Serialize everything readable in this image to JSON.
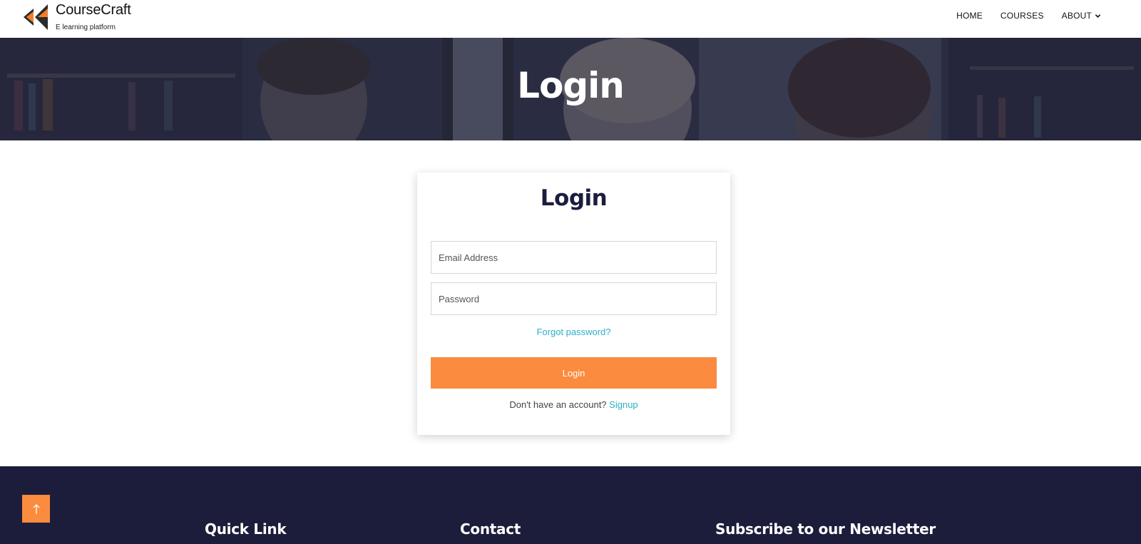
{
  "header": {
    "logo_name": "CourseCraft",
    "logo_tagline": "E learning platform",
    "nav": [
      {
        "label": "HOME"
      },
      {
        "label": "COURSES"
      },
      {
        "label": "ABOUT"
      }
    ]
  },
  "hero": {
    "title": "Login"
  },
  "login_form": {
    "title": "Login",
    "email_placeholder": "Email Address",
    "email_value": "",
    "password_placeholder": "Password",
    "password_value": "",
    "forgot_label": "Forgot password?",
    "submit_label": "Login",
    "signup_prompt": "Don't have an account?",
    "signup_label": "Signup"
  },
  "footer": {
    "quick_link_heading": "Quick Link",
    "contact_heading": "Contact",
    "newsletter_heading": "Subscribe to our Newsletter"
  },
  "scroll_top": {
    "icon": "arrow-up-icon"
  },
  "colors": {
    "accent": "#fb8b3e",
    "link": "#2bb1c7",
    "footer_bg": "#1b1d3a",
    "heading": "#1b1d3f"
  }
}
